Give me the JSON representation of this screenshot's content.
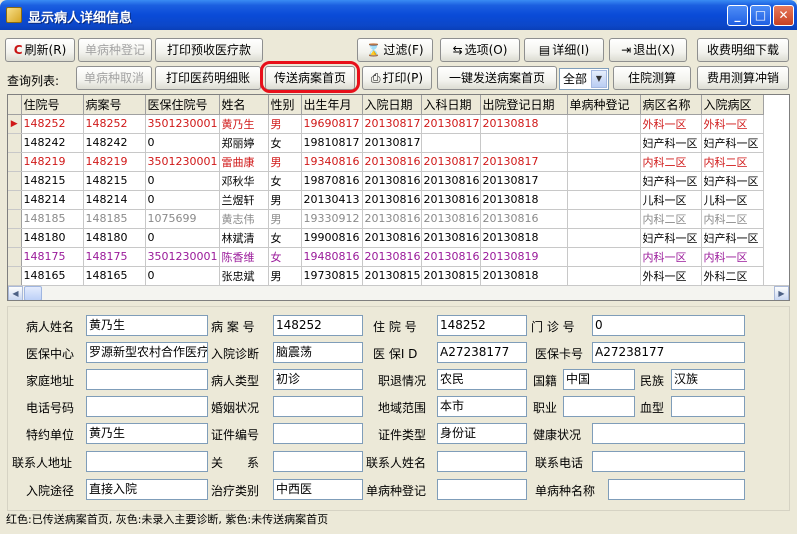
{
  "window": {
    "title": "显示病人详细信息"
  },
  "toolbar": {
    "refresh": "刷新(R)",
    "single_disease_register": "单病种登记",
    "print_prepay": "打印预收医疗款",
    "filter": "过滤(F)",
    "options": "选项(O)",
    "detail": "详细(I)",
    "exit": "退出(X)",
    "fee_detail_download": "收费明细下载",
    "query_list_label": "查询列表:",
    "single_disease_cancel": "单病种取消",
    "print_drug_detail": "打印医药明细账",
    "send_case_home": "传送病案首页",
    "print": "打印(P)",
    "one_click_send": "一键发送病案首页",
    "scope_select": "全部",
    "inpatient_calc": "住院测算",
    "fee_calc_offset": "费用测算冲销"
  },
  "grid": {
    "columns": [
      "住院号",
      "病案号",
      "医保住院号",
      "姓名",
      "性别",
      "出生年月",
      "入院日期",
      "入科日期",
      "出院登记日期",
      "单病种登记",
      "病区名称",
      "入院病区"
    ],
    "rows": [
      {
        "color": "red",
        "current": true,
        "cells": [
          "148252",
          "148252",
          "3501230001",
          "黄乃生",
          "男",
          "19690817",
          "20130817",
          "20130817",
          "20130818",
          "",
          "外科一区",
          "外科一区"
        ]
      },
      {
        "color": "black",
        "current": false,
        "cells": [
          "148242",
          "148242",
          "0",
          "郑丽婷",
          "女",
          "19810817",
          "20130817",
          "",
          "",
          "",
          "妇产科一区",
          "妇产科一区"
        ]
      },
      {
        "color": "red",
        "current": false,
        "cells": [
          "148219",
          "148219",
          "3501230001",
          "雷曲康",
          "男",
          "19340816",
          "20130816",
          "20130817",
          "20130817",
          "",
          "内科二区",
          "内科二区"
        ]
      },
      {
        "color": "black",
        "current": false,
        "cells": [
          "148215",
          "148215",
          "0",
          "邓秋华",
          "女",
          "19870816",
          "20130816",
          "20130816",
          "20130817",
          "",
          "妇产科一区",
          "妇产科一区"
        ]
      },
      {
        "color": "black",
        "current": false,
        "cells": [
          "148214",
          "148214",
          "0",
          "兰煜轩",
          "男",
          "20130413",
          "20130816",
          "20130816",
          "20130818",
          "",
          "儿科一区",
          "儿科一区"
        ]
      },
      {
        "color": "gray",
        "current": false,
        "cells": [
          "148185",
          "148185",
          "1075699",
          "黄志伟",
          "男",
          "19330912",
          "20130816",
          "20130816",
          "20130816",
          "",
          "内科二区",
          "内科二区"
        ]
      },
      {
        "color": "black",
        "current": false,
        "cells": [
          "148180",
          "148180",
          "0",
          "林斌清",
          "女",
          "19900816",
          "20130816",
          "20130816",
          "20130818",
          "",
          "妇产科一区",
          "妇产科一区"
        ]
      },
      {
        "color": "purple",
        "current": false,
        "cells": [
          "148175",
          "148175",
          "3501230001",
          "陈香维",
          "女",
          "19480816",
          "20130816",
          "20130816",
          "20130819",
          "",
          "内科一区",
          "内科一区"
        ]
      },
      {
        "color": "black",
        "current": false,
        "cells": [
          "148165",
          "148165",
          "0",
          "张忠斌",
          "男",
          "19730815",
          "20130815",
          "20130815",
          "20130818",
          "",
          "外科一区",
          "外科二区"
        ]
      }
    ]
  },
  "detail": {
    "patient_name_label": "病人姓名",
    "patient_name": "黄乃生",
    "case_no_label": "病 案 号",
    "case_no": "148252",
    "inpatient_no_label": "住 院 号",
    "inpatient_no": "148252",
    "outpatient_no_label": "门 诊 号",
    "outpatient_no": "0",
    "insurance_center_label": "医保中心",
    "insurance_center": "罗源新型农村合作医疗",
    "admit_diag_label": "入院诊断",
    "admit_diag": "脑震荡",
    "insurance_id_label": "医 保I D",
    "insurance_id": "A27238177",
    "insurance_card_label": "医保卡号",
    "insurance_card": "A27238177",
    "home_addr_label": "家庭地址",
    "home_addr": "",
    "patient_type_label": "病人类型",
    "patient_type": "初诊",
    "job_status_label": "职退情况",
    "job_status": "农民",
    "nationality_label": "国籍",
    "nationality": "中国",
    "ethnicity_label": "民族",
    "ethnicity": "汉族",
    "phone_label": "电话号码",
    "phone": "",
    "marital_label": "婚姻状况",
    "marital": "",
    "region_label": "地域范围",
    "region": "本市",
    "occupation_label": "职业",
    "occupation": "",
    "blood_label": "血型",
    "blood": "",
    "contract_unit_label": "特约单位",
    "contract_unit": "黄乃生",
    "cert_no_label": "证件编号",
    "cert_no": "",
    "cert_type_label": "证件类型",
    "cert_type": "身份证",
    "health_label": "健康状况",
    "health": "",
    "contact_addr_label": "联系人地址",
    "contact_addr": "",
    "relation_label": "关　　系",
    "relation": "",
    "contact_name_label": "联系人姓名",
    "contact_name": "",
    "contact_phone_label": "联系电话",
    "contact_phone": "",
    "admit_route_label": "入院途径",
    "admit_route": "直接入院",
    "treat_type_label": "治疗类别",
    "treat_type": "中西医",
    "single_reg_label": "单病种登记",
    "single_reg": "",
    "single_name_label": "单病种名称",
    "single_name": ""
  },
  "status": {
    "legend": "红色:已传送病案首页, 灰色:未录入主要诊断, 紫色:未传送病案首页"
  },
  "colors": {
    "red": "#d01818",
    "gray": "#8a8a8a",
    "purple": "#9a1a9a",
    "highlight": "#e8101a"
  }
}
